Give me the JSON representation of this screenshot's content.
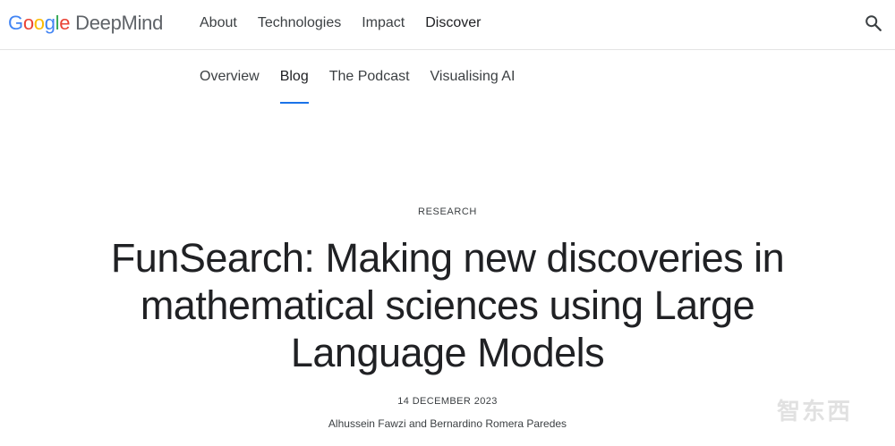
{
  "brand": {
    "google_letters": [
      "G",
      "o",
      "o",
      "g",
      "l",
      "e"
    ],
    "product": "DeepMind"
  },
  "main_nav": [
    {
      "label": "About"
    },
    {
      "label": "Technologies"
    },
    {
      "label": "Impact"
    },
    {
      "label": "Discover",
      "active": true
    }
  ],
  "search": {
    "icon": "search-icon"
  },
  "sub_nav": [
    {
      "label": "Overview"
    },
    {
      "label": "Blog",
      "active": true
    },
    {
      "label": "The Podcast"
    },
    {
      "label": "Visualising AI"
    }
  ],
  "article": {
    "category": "RESEARCH",
    "title": "FunSearch: Making new discoveries in mathematical sciences using Large Language Models",
    "date": "14 DECEMBER 2023",
    "authors": "Alhussein Fawzi and Bernardino Romera Paredes"
  },
  "watermark": "智东西",
  "colors": {
    "accent_underline": "#1a73e8",
    "google_blue": "#4285F4",
    "google_red": "#EA4335",
    "google_yellow": "#FBBC05",
    "google_green": "#34A853"
  }
}
